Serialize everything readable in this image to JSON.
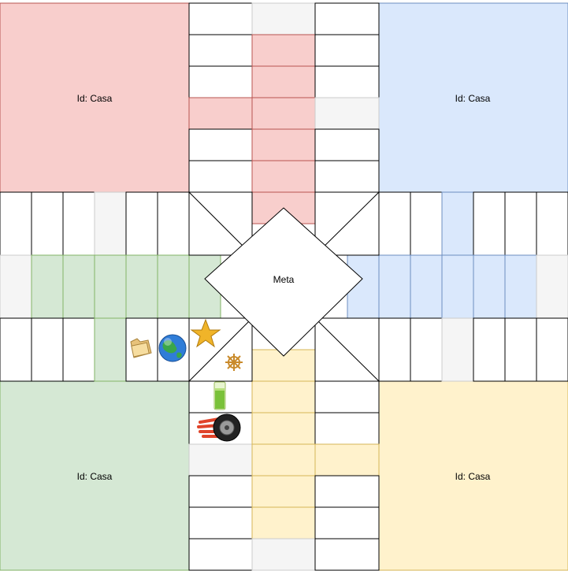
{
  "board": {
    "homes": [
      {
        "id": "red",
        "label": "Id: Casa",
        "color": "#f8cecc",
        "stroke": "#b85450"
      },
      {
        "id": "blue",
        "label": "Id: Casa",
        "color": "#dae8fc",
        "stroke": "#6c8ebf"
      },
      {
        "id": "green",
        "label": "Id: Casa",
        "color": "#d5e8d4",
        "stroke": "#82b366"
      },
      {
        "id": "yellow",
        "label": "Id: Casa",
        "color": "#fff2cc",
        "stroke": "#d6b656"
      }
    ],
    "center_label": "Meta",
    "safe_color": "#f5f5f5",
    "icons": [
      "folder-icon",
      "globe-icon",
      "star-icon",
      "ship-wheel-icon",
      "energy-drink-icon",
      "speeding-tire-icon"
    ]
  }
}
